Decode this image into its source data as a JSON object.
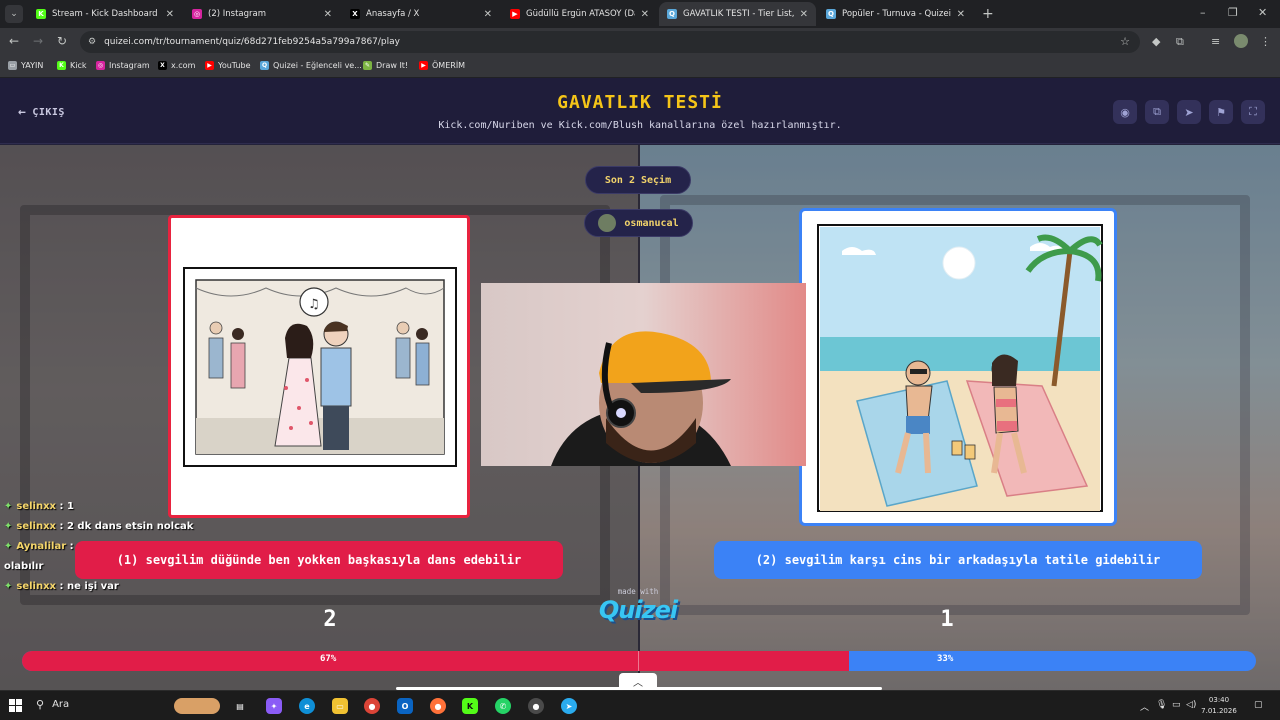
{
  "browser": {
    "tabs": [
      {
        "title": "Stream - Kick Dashboard",
        "icon": "kick-icon",
        "color": "#53fc18",
        "glyph": "K"
      },
      {
        "title": "(2) Instagram",
        "icon": "instagram-icon",
        "color": "#d6249f",
        "glyph": "◎"
      },
      {
        "title": "Anasayfa / X",
        "icon": "x-icon",
        "color": "#000000",
        "glyph": "X"
      },
      {
        "title": "Güdüllü Ergün ATASOY (Dağla",
        "icon": "youtube-icon",
        "color": "#ff0000",
        "glyph": "▶"
      },
      {
        "title": "GAVATLIK TESTİ - Tier List, Kör",
        "icon": "quizei-icon",
        "color": "#5aa7d9",
        "glyph": "Q"
      },
      {
        "title": "Popüler - Turnuva - Quizei",
        "icon": "quizei-icon",
        "color": "#5aa7d9",
        "glyph": "Q"
      }
    ],
    "url": "quizei.com/tr/tournament/quiz/68d271feb9254a5a799a7867/play",
    "bookmarks": [
      {
        "label": "YAYIN",
        "icon": "folder-icon",
        "color": "#9aa0a6",
        "glyph": "▭"
      },
      {
        "label": "Kick",
        "icon": "kick-icon",
        "color": "#53fc18",
        "glyph": "K"
      },
      {
        "label": "Instagram",
        "icon": "instagram-icon",
        "color": "#d6249f",
        "glyph": "◎"
      },
      {
        "label": "x.com",
        "icon": "x-icon",
        "color": "#000000",
        "glyph": "X"
      },
      {
        "label": "YouTube",
        "icon": "youtube-icon",
        "color": "#ff0000",
        "glyph": "▶"
      },
      {
        "label": "Quizei - Eğlenceli ve...",
        "icon": "quizei-icon",
        "color": "#5aa7d9",
        "glyph": "Q"
      },
      {
        "label": "Draw It!",
        "icon": "draw-icon",
        "color": "#7cb342",
        "glyph": "✎"
      },
      {
        "label": "ÖMERİM",
        "icon": "youtube-icon",
        "color": "#ff0000",
        "glyph": "▶"
      }
    ]
  },
  "quiz": {
    "exit_label": "ÇIKIŞ",
    "title": "GAVATLIK TESTİ",
    "subtitle": "Kick.com/Nuriben ve Kick.com/Blush kanallarına özel hazırlanmıştır.",
    "round_label": "Son 2 Seçim",
    "creator": "osmanucal",
    "left_choice": "(1) sevgilim düğünde ben yokken başkasıyla dans edebilir",
    "right_choice": "(2) sevgilim karşı cins bir arkadaşıyla tatile gidebilir",
    "left_votes": "2",
    "right_votes": "1",
    "left_percent_label": "67%",
    "right_percent_label": "33%",
    "left_share": 0.67,
    "made_with": "made with",
    "brand": "Quizei",
    "colors": {
      "left": "#e11d48",
      "right": "#3b82f6",
      "title": "#f5c518"
    }
  },
  "chat": [
    {
      "user": "selinxx",
      "text": ": 1"
    },
    {
      "user": "selinxx",
      "text": ": 2 dk dans etsin nolcak"
    },
    {
      "user": "Aynalilar",
      "text": ": ıs yerınden arkadaslarıyla olabılır"
    },
    {
      "user": "selinxx",
      "text": ": ne işi var"
    }
  ],
  "taskbar": {
    "search_label": "Ara",
    "time": "03:40",
    "date": "7.01.2026"
  }
}
